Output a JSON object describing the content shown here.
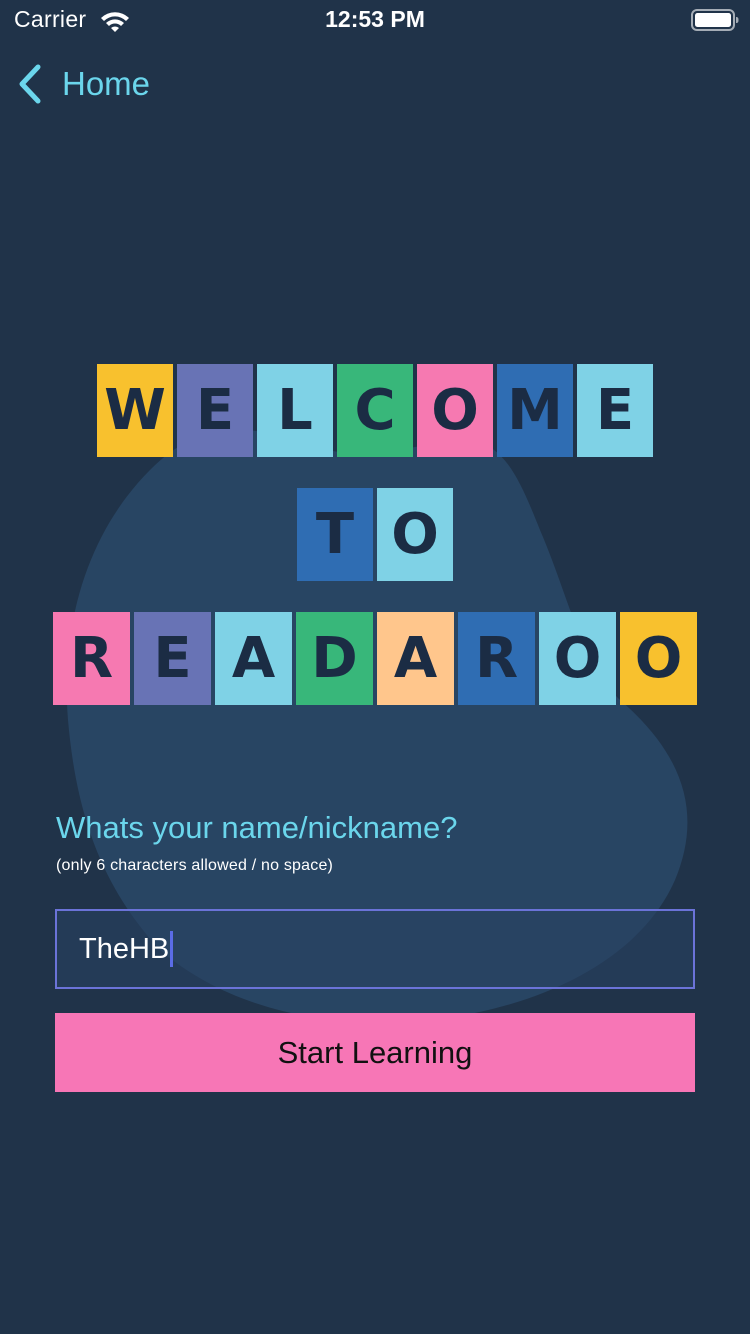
{
  "status_bar": {
    "carrier": "Carrier",
    "time": "12:53 PM",
    "wifi_icon": "wifi-icon",
    "battery_icon": "battery-icon"
  },
  "nav": {
    "back_label": "Home",
    "back_icon": "chevron-left-icon"
  },
  "title": {
    "rows": [
      [
        {
          "letter": "W",
          "color": "#f8c12e"
        },
        {
          "letter": "E",
          "color": "#6873b5"
        },
        {
          "letter": "L",
          "color": "#7fd2e6"
        },
        {
          "letter": "C",
          "color": "#38b77a"
        },
        {
          "letter": "O",
          "color": "#f679b1"
        },
        {
          "letter": "M",
          "color": "#2f6db3"
        },
        {
          "letter": "E",
          "color": "#7fd2e6"
        }
      ],
      [
        {
          "letter": "T",
          "color": "#2f6db3"
        },
        {
          "letter": "O",
          "color": "#7fd2e6"
        }
      ],
      [
        {
          "letter": "R",
          "color": "#f679b1"
        },
        {
          "letter": "E",
          "color": "#6873b5"
        },
        {
          "letter": "A",
          "color": "#7fd2e6"
        },
        {
          "letter": "D",
          "color": "#38b77a"
        },
        {
          "letter": "A",
          "color": "#ffc68c"
        },
        {
          "letter": "R",
          "color": "#2f6db3"
        },
        {
          "letter": "O",
          "color": "#7fd2e6"
        },
        {
          "letter": "O",
          "color": "#f8c12e"
        }
      ]
    ]
  },
  "form": {
    "question": "Whats your name/nickname?",
    "hint": "(only 6 characters allowed / no space)",
    "name_value": "TheHB",
    "submit_label": "Start Learning"
  },
  "colors": {
    "background": "#203349",
    "accent": "#6bd6ec",
    "button": "#f776b6",
    "input_border": "#6b73d8"
  }
}
